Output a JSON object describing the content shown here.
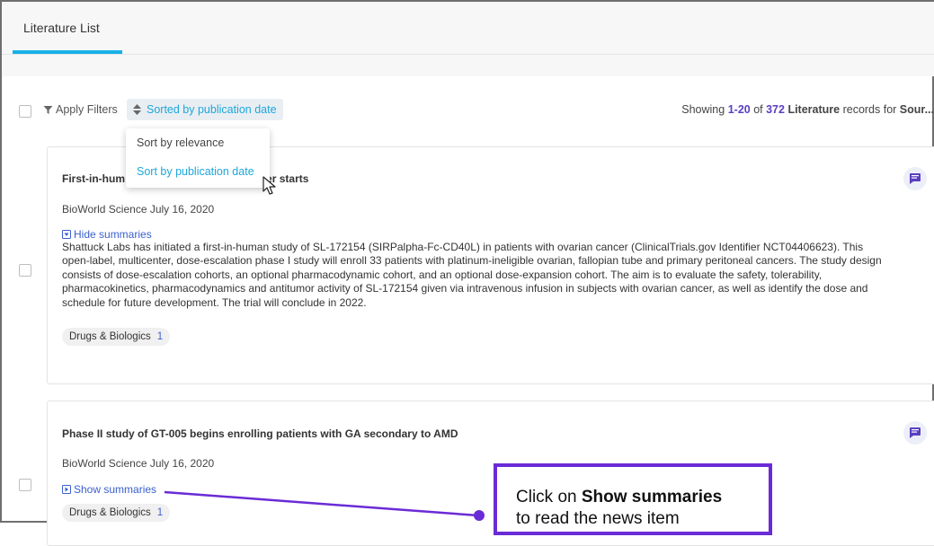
{
  "header": {
    "tab_title": "Literature List"
  },
  "toolbar": {
    "apply_filters": "Apply Filters",
    "sort_label": "Sorted by publication date",
    "showing_prefix": "Showing ",
    "range": "1-20",
    "of": " of ",
    "total": "372",
    "type": "Literature",
    "records_for": " records for ",
    "source": "Sour..."
  },
  "sort_menu": {
    "options": [
      "Sort by relevance",
      "Sort by publication date"
    ],
    "selected": "Sort by publication date"
  },
  "records": [
    {
      "title_start": "First-in-hum",
      "title_end": "varian cancer starts",
      "source_date": "BioWorld Science July 16, 2020",
      "toggle_label": "Hide summaries",
      "summary": "Shattuck Labs has initiated a first-in-human study of SL-172154 (SIRPalpha-Fc-CD40L) in patients with ovarian cancer (ClinicalTrials.gov Identifier NCT04406623). This open-label, multicenter, dose-escalation phase I study will enroll 33 patients with platinum-ineligible ovarian, fallopian tube and primary peritoneal cancers. The study design consists of dose-escalation cohorts, an optional pharmacodynamic cohort, and an optional dose-expansion cohort. The aim is to evaluate the safety, tolerability, pharmacokinetics, pharmacodynamics and antitumor activity of SL-172154 given via intravenous infusion in subjects with ovarian cancer, as well as identify the dose and schedule for future development. The trial will conclude in 2022.",
      "tag_label": "Drugs & Biologics",
      "tag_count": "1"
    },
    {
      "title": "Phase II study of GT-005 begins enrolling patients with GA secondary to AMD",
      "source_date": "BioWorld Science July 16, 2020",
      "toggle_label": "Show summaries",
      "tag_label": "Drugs & Biologics",
      "tag_count": "1"
    }
  ],
  "callout": {
    "prefix": "Click on ",
    "bold": "Show summaries",
    "line2": "to read the news item"
  },
  "colors": {
    "accent": "#19b1e6",
    "link": "#3a5fcf",
    "callout_border": "#6a2bd6",
    "count_purple": "#5a3fc0"
  }
}
